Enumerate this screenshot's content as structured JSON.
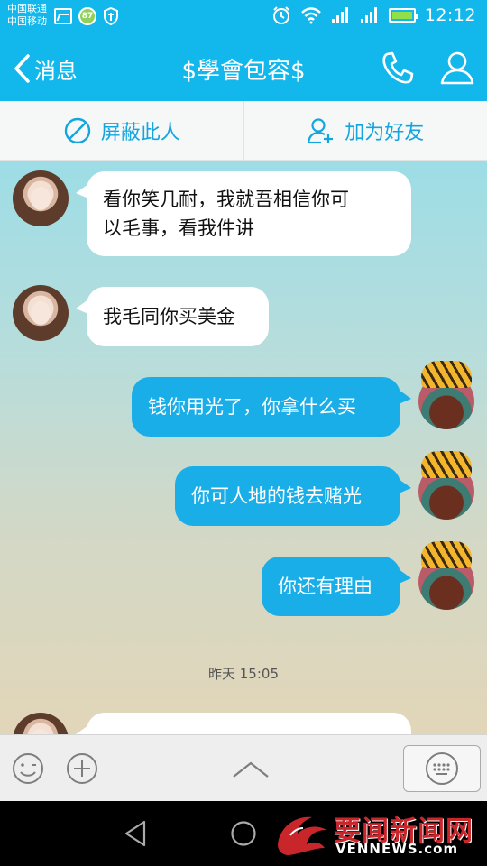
{
  "status_bar": {
    "carrier_1": "中国联通",
    "carrier_2": "中国移动",
    "badge_value": "87",
    "time": "12:12",
    "icons": [
      "gallery-icon",
      "badge-icon",
      "shield-icon",
      "alarm-icon",
      "wifi-icon",
      "signal-icon",
      "signal-icon",
      "battery-icon"
    ]
  },
  "header": {
    "back_label": "消息",
    "title": "$學會包容$",
    "icons": [
      "back-chevron-icon",
      "phone-icon",
      "profile-icon"
    ]
  },
  "action_bar": {
    "block_label": "屏蔽此人",
    "add_friend_label": "加为好友",
    "icons": [
      "block-icon",
      "add-friend-icon"
    ]
  },
  "messages": [
    {
      "direction": "incoming",
      "lines": [
        "看你笑几耐，我就吾相信你可",
        "以毛事，看我件讲"
      ]
    },
    {
      "direction": "incoming",
      "lines": [
        "我毛同你买美金"
      ]
    },
    {
      "direction": "outgoing",
      "lines": [
        "钱你用光了，你拿什么买"
      ]
    },
    {
      "direction": "outgoing",
      "lines": [
        "你可人地的钱去赌光"
      ]
    },
    {
      "direction": "outgoing",
      "lines": [
        "你还有理由"
      ]
    }
  ],
  "timestamp": "昨天 15:05",
  "input_bar": {
    "icons": [
      "emoji-icon",
      "plus-icon",
      "chevron-up-icon",
      "keyboard-icon"
    ]
  },
  "nav_bar": {
    "icons": [
      "nav-back-icon",
      "nav-home-icon"
    ]
  },
  "watermark": {
    "title": "要闻新闻网",
    "domain": "VENNEWS.com"
  },
  "colors": {
    "brand": "#12b7ec",
    "outgoing_bubble": "#1aaee9",
    "incoming_bubble": "#ffffff",
    "watermark_red": "#c9262c"
  }
}
